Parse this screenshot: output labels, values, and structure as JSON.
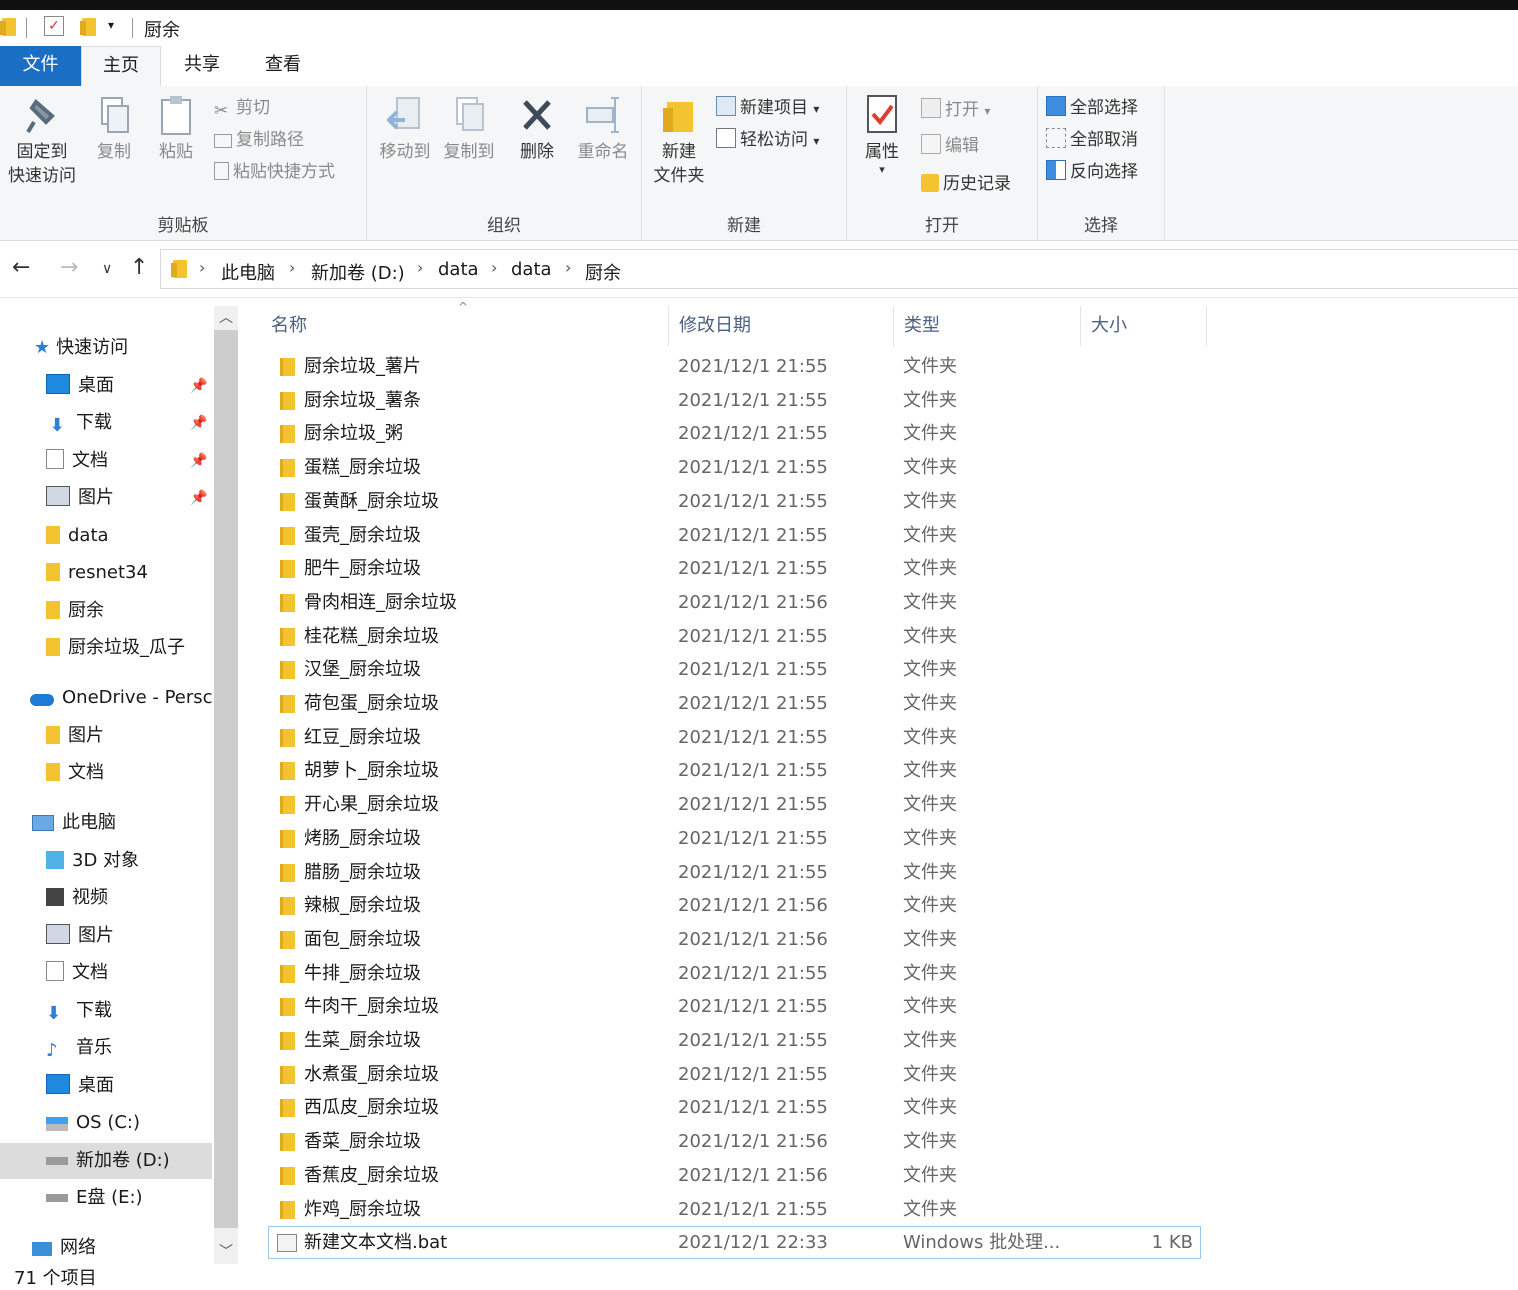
{
  "window": {
    "title": "厨余"
  },
  "tabs": {
    "file": "文件",
    "home": "主页",
    "share": "共享",
    "view": "查看"
  },
  "ribbon": {
    "clipboard": {
      "label": "剪贴板",
      "pin_l1": "固定到",
      "pin_l2": "快速访问",
      "copy": "复制",
      "paste": "粘贴",
      "cut": "剪切",
      "copy_path": "复制路径",
      "paste_shortcut": "粘贴快捷方式"
    },
    "organize": {
      "label": "组织",
      "move_to": "移动到",
      "copy_to": "复制到",
      "delete": "删除",
      "rename": "重命名"
    },
    "new": {
      "label": "新建",
      "new_folder_l1": "新建",
      "new_folder_l2": "文件夹",
      "new_item": "新建项目",
      "easy_access": "轻松访问"
    },
    "open": {
      "label": "打开",
      "properties": "属性",
      "open": "打开",
      "edit": "编辑",
      "history": "历史记录"
    },
    "select": {
      "label": "选择",
      "select_all": "全部选择",
      "select_none": "全部取消",
      "invert": "反向选择"
    }
  },
  "address": {
    "crumbs": [
      "此电脑",
      "新加卷 (D:)",
      "data",
      "data",
      "厨余"
    ]
  },
  "sidebar": {
    "quick_access": "快速访问",
    "quick_items": [
      "桌面",
      "下载",
      "文档",
      "图片",
      "data",
      "resnet34",
      "厨余",
      "厨余垃圾_瓜子"
    ],
    "onedrive": "OneDrive - Persc",
    "onedrive_items": [
      "图片",
      "文档"
    ],
    "this_pc": "此电脑",
    "pc_items": [
      "3D 对象",
      "视频",
      "图片",
      "文档",
      "下载",
      "音乐",
      "桌面",
      "OS (C:)",
      "新加卷 (D:)",
      "E盘 (E:)"
    ],
    "network": "网络"
  },
  "columns": {
    "name": "名称",
    "date": "修改日期",
    "type": "类型",
    "size": "大小"
  },
  "files": [
    {
      "name": "厨余垃圾_薯片",
      "date": "2021/12/1 21:55",
      "type": "文件夹",
      "size": ""
    },
    {
      "name": "厨余垃圾_薯条",
      "date": "2021/12/1 21:55",
      "type": "文件夹",
      "size": ""
    },
    {
      "name": "厨余垃圾_粥",
      "date": "2021/12/1 21:55",
      "type": "文件夹",
      "size": ""
    },
    {
      "name": "蛋糕_厨余垃圾",
      "date": "2021/12/1 21:55",
      "type": "文件夹",
      "size": ""
    },
    {
      "name": "蛋黄酥_厨余垃圾",
      "date": "2021/12/1 21:55",
      "type": "文件夹",
      "size": ""
    },
    {
      "name": "蛋壳_厨余垃圾",
      "date": "2021/12/1 21:55",
      "type": "文件夹",
      "size": ""
    },
    {
      "name": "肥牛_厨余垃圾",
      "date": "2021/12/1 21:55",
      "type": "文件夹",
      "size": ""
    },
    {
      "name": "骨肉相连_厨余垃圾",
      "date": "2021/12/1 21:56",
      "type": "文件夹",
      "size": ""
    },
    {
      "name": "桂花糕_厨余垃圾",
      "date": "2021/12/1 21:55",
      "type": "文件夹",
      "size": ""
    },
    {
      "name": "汉堡_厨余垃圾",
      "date": "2021/12/1 21:55",
      "type": "文件夹",
      "size": ""
    },
    {
      "name": "荷包蛋_厨余垃圾",
      "date": "2021/12/1 21:55",
      "type": "文件夹",
      "size": ""
    },
    {
      "name": "红豆_厨余垃圾",
      "date": "2021/12/1 21:55",
      "type": "文件夹",
      "size": ""
    },
    {
      "name": "胡萝卜_厨余垃圾",
      "date": "2021/12/1 21:55",
      "type": "文件夹",
      "size": ""
    },
    {
      "name": "开心果_厨余垃圾",
      "date": "2021/12/1 21:55",
      "type": "文件夹",
      "size": ""
    },
    {
      "name": "烤肠_厨余垃圾",
      "date": "2021/12/1 21:55",
      "type": "文件夹",
      "size": ""
    },
    {
      "name": "腊肠_厨余垃圾",
      "date": "2021/12/1 21:55",
      "type": "文件夹",
      "size": ""
    },
    {
      "name": "辣椒_厨余垃圾",
      "date": "2021/12/1 21:56",
      "type": "文件夹",
      "size": ""
    },
    {
      "name": "面包_厨余垃圾",
      "date": "2021/12/1 21:56",
      "type": "文件夹",
      "size": ""
    },
    {
      "name": "牛排_厨余垃圾",
      "date": "2021/12/1 21:55",
      "type": "文件夹",
      "size": ""
    },
    {
      "name": "牛肉干_厨余垃圾",
      "date": "2021/12/1 21:55",
      "type": "文件夹",
      "size": ""
    },
    {
      "name": "生菜_厨余垃圾",
      "date": "2021/12/1 21:55",
      "type": "文件夹",
      "size": ""
    },
    {
      "name": "水煮蛋_厨余垃圾",
      "date": "2021/12/1 21:55",
      "type": "文件夹",
      "size": ""
    },
    {
      "name": "西瓜皮_厨余垃圾",
      "date": "2021/12/1 21:55",
      "type": "文件夹",
      "size": ""
    },
    {
      "name": "香菜_厨余垃圾",
      "date": "2021/12/1 21:56",
      "type": "文件夹",
      "size": ""
    },
    {
      "name": "香蕉皮_厨余垃圾",
      "date": "2021/12/1 21:56",
      "type": "文件夹",
      "size": ""
    },
    {
      "name": "炸鸡_厨余垃圾",
      "date": "2021/12/1 21:55",
      "type": "文件夹",
      "size": ""
    },
    {
      "name": "新建文本文档.bat",
      "date": "2021/12/1 22:33",
      "type": "Windows 批处理...",
      "size": "1 KB"
    }
  ],
  "status": {
    "count": "71 个项目"
  }
}
